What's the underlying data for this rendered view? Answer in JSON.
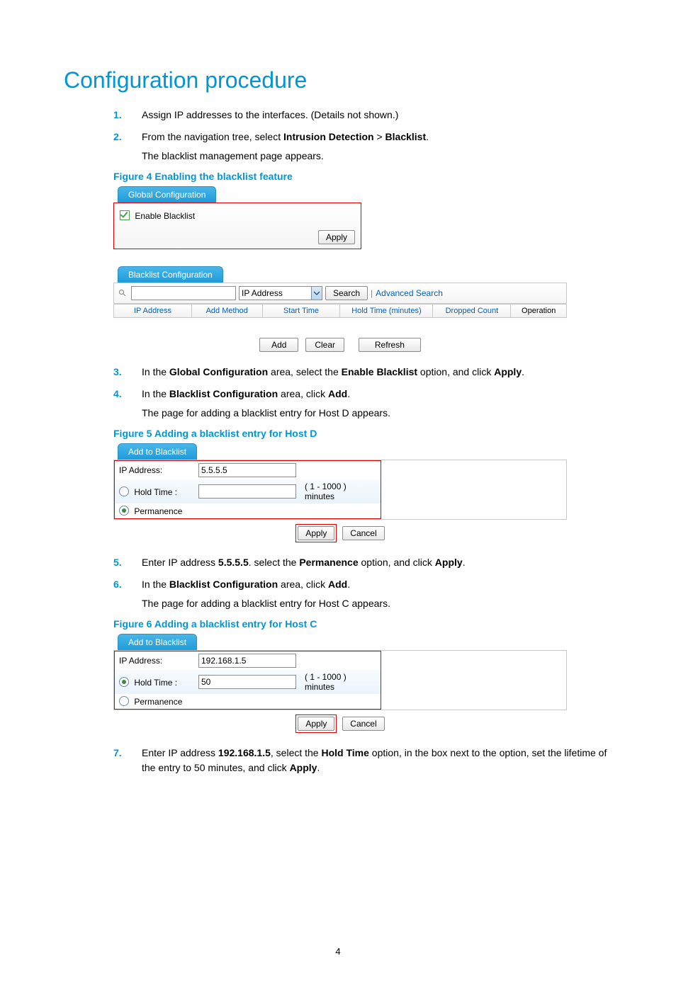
{
  "page": {
    "title": "Configuration procedure",
    "number": "4"
  },
  "steps": {
    "s1": {
      "num": "1.",
      "text": "Assign IP addresses to the interfaces. (Details not shown.)"
    },
    "s2": {
      "num": "2.",
      "pre": "From the navigation tree, select ",
      "b1": "Intrusion Detection",
      "mid": " > ",
      "b2": "Blacklist",
      "post": ".",
      "sub": "The blacklist management page appears."
    },
    "s3": {
      "num": "3.",
      "pre": "In the ",
      "b1": "Global Configuration",
      "mid1": " area, select the ",
      "b2": "Enable Blacklist",
      "mid2": " option, and click ",
      "b3": "Apply",
      "post": "."
    },
    "s4": {
      "num": "4.",
      "pre": "In the ",
      "b1": "Blacklist Configuration",
      "mid": " area, click ",
      "b2": "Add",
      "post": ".",
      "sub": "The page for adding a blacklist entry for Host D appears."
    },
    "s5": {
      "num": "5.",
      "pre": "Enter IP address ",
      "b1": "5.5.5.5",
      "mid1": ". select the ",
      "b2": "Permanence",
      "mid2": " option, and click ",
      "b3": "Apply",
      "post": "."
    },
    "s6": {
      "num": "6.",
      "pre": "In the ",
      "b1": "Blacklist Configuration",
      "mid": " area, click ",
      "b2": "Add",
      "post": ".",
      "sub": "The page for adding a blacklist entry for Host C appears."
    },
    "s7": {
      "num": "7.",
      "pre": "Enter IP address ",
      "b1": "192.168.1.5",
      "mid1": ", select the ",
      "b2": "Hold Time",
      "mid2": " option, in the box next to the option, set the lifetime of the entry to 50 minutes, and click ",
      "b3": "Apply",
      "post": "."
    }
  },
  "figures": {
    "f4": "Figure 4 Enabling the blacklist feature",
    "f5": "Figure 5 Adding a blacklist entry for Host D",
    "f6": "Figure 6 Adding a blacklist entry for Host C"
  },
  "fig1": {
    "tab_global": "Global Configuration",
    "enable_label": "Enable Blacklist",
    "apply": "Apply",
    "tab_blacklist": "Blacklist Configuration",
    "search_field": "IP Address",
    "search_btn": "Search",
    "adv_search": "Advanced Search",
    "cols": {
      "ip": "IP Address",
      "method": "Add Method",
      "start": "Start Time",
      "hold": "Hold Time (minutes)",
      "dropped": "Dropped Count",
      "op": "Operation"
    },
    "add": "Add",
    "clear": "Clear",
    "refresh": "Refresh"
  },
  "fig5": {
    "tab": "Add to Blacklist",
    "ip_label": "IP Address:",
    "ip_value": "5.5.5.5",
    "hold_label": "Hold Time :",
    "hold_hint": "( 1 - 1000 ) minutes",
    "perm_label": "Permanence",
    "apply": "Apply",
    "cancel": "Cancel"
  },
  "fig6": {
    "tab": "Add to Blacklist",
    "ip_label": "IP Address:",
    "ip_value": "192.168.1.5",
    "hold_label": "Hold Time :",
    "hold_value": "50",
    "hold_hint": "( 1 - 1000 ) minutes",
    "perm_label": "Permanence",
    "apply": "Apply",
    "cancel": "Cancel"
  }
}
